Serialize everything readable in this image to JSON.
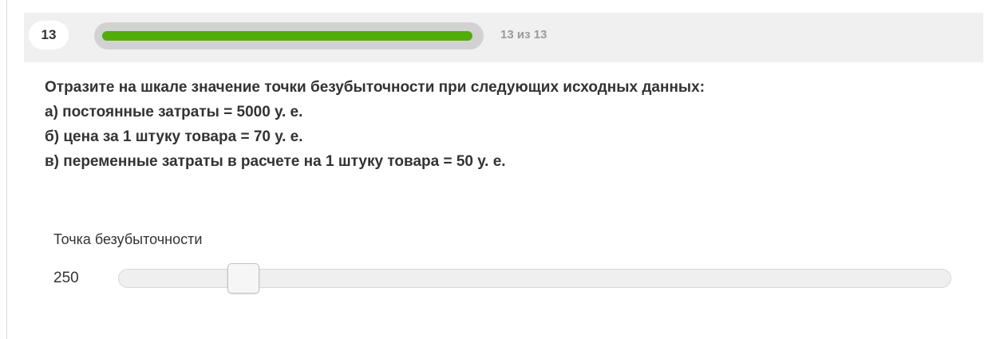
{
  "header": {
    "question_number": "13",
    "progress_text": "13 из 13",
    "progress_fraction": 1.0,
    "progress_color": "#52ad0a"
  },
  "question": {
    "lines": [
      "Отразите на шкале значение точки безубыточности при следующих исходных данных:",
      "а) постоянные затраты = 5000 у. е.",
      "б) цена за 1 штуку товара = 70 у. е.",
      "в) переменные затраты в расчете на 1 штуку товара = 50 у. е."
    ]
  },
  "slider": {
    "label": "Точка безубыточности",
    "value": "250",
    "position_fraction": 0.15
  }
}
